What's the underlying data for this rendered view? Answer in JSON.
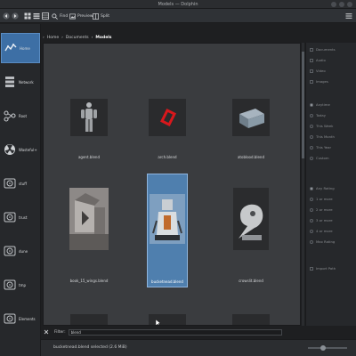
{
  "window": {
    "title": "Models — Dolphin"
  },
  "toolbar": {
    "find_label": "Find",
    "preview_label": "Preview",
    "split_label": "Split"
  },
  "places": [
    {
      "label": "Home",
      "icon": "home-icon",
      "active": true
    },
    {
      "label": "Network",
      "icon": "network-icon"
    },
    {
      "label": "Root",
      "icon": "root-icon"
    },
    {
      "label": "Wasteful+",
      "icon": "hazard-icon"
    },
    {
      "label": "stuff",
      "icon": "harddrive-icon"
    },
    {
      "label": "trust",
      "icon": "harddrive-icon"
    },
    {
      "label": "dune",
      "icon": "harddrive-icon"
    },
    {
      "label": "tmp",
      "icon": "harddrive-icon"
    },
    {
      "label": "Elements",
      "icon": "harddrive-icon"
    }
  ],
  "breadcrumb": {
    "home": "Home",
    "documents": "Documents",
    "current": "Models"
  },
  "files": [
    {
      "name": "agent.blend",
      "thumb": "figure"
    },
    {
      "name": "arch.blend",
      "thumb": "red-box"
    },
    {
      "name": "atoblood.blend",
      "thumb": "crate"
    },
    {
      "name": "book_15_wings.blend",
      "thumb": "scene"
    },
    {
      "name": "bucketnead.blend",
      "thumb": "bucket-head",
      "selected": true
    },
    {
      "name": "crowslit.blend",
      "thumb": "plague-mask"
    }
  ],
  "filter": {
    "label": "Filter:",
    "value": "blend"
  },
  "status": {
    "text": "bucketnead.blend selected (2.6 MiB)"
  },
  "filters": {
    "types": [
      "Documents",
      "Audio",
      "Video",
      "Images"
    ],
    "dates": [
      "Anytime",
      "Today",
      "This Week",
      "This Month",
      "This Year",
      "Custom"
    ],
    "ratings": [
      "Any Rating",
      "1 or more",
      "2 or more",
      "3 or more",
      "4 or more",
      "Max Rating"
    ],
    "extra": "Import Path"
  },
  "colors": {
    "selection": "#3d6fa5",
    "background": "#3a3c3f"
  }
}
